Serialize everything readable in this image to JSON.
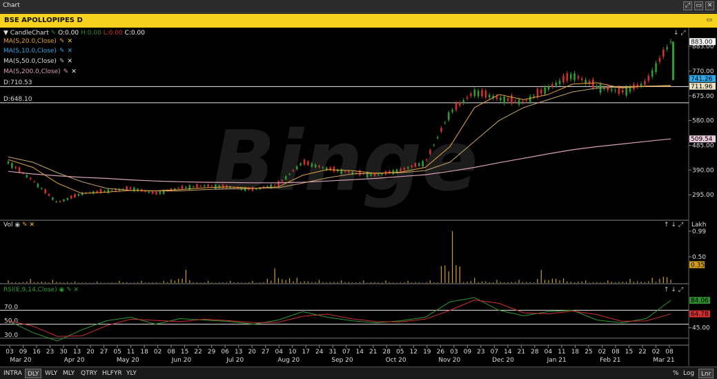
{
  "window": {
    "title": "Chart"
  },
  "window_controls": [
    "⤢",
    "▭",
    "✕"
  ],
  "chart_header": {
    "title": "BSE APOLLOPIPES D",
    "collapse_icon": "▭"
  },
  "ohlc": {
    "label": "CandleChart",
    "open": "O:0.00",
    "high": "H:0.00",
    "low": "L:0.00",
    "close": "C:0.00"
  },
  "indicators": [
    {
      "label": "MA(S,20.0,Close)",
      "color": "#e8a33a"
    },
    {
      "label": "MA(S,10.0,Close)",
      "color": "#2fa8e8"
    },
    {
      "label": "MA(S,50.0,Close)",
      "color": "#c9a46a"
    },
    {
      "label": "MA(S,200.0,Close)",
      "color": "#d9a0b8"
    }
  ],
  "hlines": [
    {
      "label": "D:710.53",
      "price": 710.53
    },
    {
      "label": "D:648.10",
      "price": 648.1
    }
  ],
  "price_axis": {
    "ticks": [
      "883.00",
      "770.00",
      "675.00",
      "580.00",
      "485.00",
      "390.00",
      "295.00"
    ],
    "tick_values": [
      865,
      770,
      675,
      580,
      485,
      390,
      295
    ],
    "ylim": [
      200,
      905
    ],
    "markers": [
      {
        "label": "883.00",
        "value": 883,
        "bg": "#ffffff",
        "fg": "#000000"
      },
      {
        "label": "741.26",
        "value": 741.26,
        "bg": "#2fa8e8",
        "fg": "#000000"
      },
      {
        "label": "711.96",
        "value": 711.96,
        "bg": "#e8e0c0",
        "fg": "#000000"
      },
      {
        "label": "509.54",
        "value": 509.54,
        "bg": "#e8c8d8",
        "fg": "#000000"
      }
    ]
  },
  "volume": {
    "label": "Vol",
    "unit": "Lakh",
    "ticks": [
      "0.99",
      "0.50"
    ],
    "tick_values": [
      0.99,
      0.5
    ],
    "ylim": [
      0,
      1.12
    ],
    "marker": {
      "label": "0.35",
      "value": 0.35
    }
  },
  "rsi": {
    "label": "RSI(E,9,14,Close)",
    "ticks": [
      "70.0",
      "50.0",
      "30.0"
    ],
    "tick_values": [
      70,
      50,
      30
    ],
    "right_ticks": [
      "45.00"
    ],
    "right_tick_values": [
      45
    ],
    "ylim": [
      20,
      100
    ],
    "markers": [
      {
        "label": "84.06",
        "value": 84.06,
        "bg": "#2e8b2e",
        "fg": "#000000"
      },
      {
        "label": "64.78",
        "value": 64.78,
        "bg": "#d23030",
        "fg": "#000000"
      }
    ]
  },
  "x_axis": {
    "days": [
      "03",
      "09",
      "16",
      "23",
      "30",
      "13",
      "20",
      "27",
      "05",
      "11",
      "18",
      "02",
      "08",
      "15",
      "22",
      "29",
      "06",
      "13",
      "20",
      "27",
      "04",
      "10",
      "17",
      "24",
      "31",
      "07",
      "14",
      "21",
      "28",
      "05",
      "12",
      "19",
      "26",
      "03",
      "09",
      "23",
      "07",
      "14",
      "21",
      "28",
      "04",
      "11",
      "18",
      "25",
      "02",
      "08",
      "15",
      "22",
      "02",
      "08"
    ],
    "months": [
      "Mar 20",
      "Apr 20",
      "May 20",
      "Jun 20",
      "Jul 20",
      "Aug 20",
      "Sep 20",
      "Oct 20",
      "Nov 20",
      "Dec 20",
      "Jan 21",
      "Feb 21",
      "Mar 21"
    ]
  },
  "watermark": "Binge",
  "period_tabs": [
    "INTRA",
    "DLY",
    "WLY",
    "MLY",
    "QTRY",
    "HLFYR",
    "YLY"
  ],
  "active_period": "DLY",
  "scale_tools": [
    "%",
    "Log",
    "Lnr"
  ],
  "active_scale": "Lnr",
  "chart_data": {
    "type": "line",
    "title": "BSE APOLLOPIPES D",
    "x": [
      "2020-03-03",
      "2020-03-16",
      "2020-03-30",
      "2020-04-13",
      "2020-04-27",
      "2020-05-11",
      "2020-05-25",
      "2020-06-08",
      "2020-06-22",
      "2020-07-06",
      "2020-07-20",
      "2020-08-03",
      "2020-08-17",
      "2020-08-31",
      "2020-09-14",
      "2020-09-28",
      "2020-10-12",
      "2020-10-26",
      "2020-11-09",
      "2020-11-23",
      "2020-12-07",
      "2020-12-21",
      "2021-01-04",
      "2021-01-18",
      "2021-02-01",
      "2021-02-15",
      "2021-03-01",
      "2021-03-08"
    ],
    "series": [
      {
        "name": "Close",
        "values": [
          420,
          350,
          265,
          300,
          310,
          320,
          300,
          322,
          330,
          325,
          315,
          335,
          420,
          395,
          380,
          370,
          390,
          420,
          610,
          690,
          665,
          650,
          705,
          755,
          710,
          690,
          725,
          883
        ]
      },
      {
        "name": "MA(S,20.0,Close)",
        "values": [
          430,
          400,
          340,
          300,
          305,
          312,
          310,
          315,
          322,
          325,
          320,
          325,
          370,
          392,
          388,
          377,
          382,
          400,
          480,
          630,
          680,
          660,
          680,
          720,
          725,
          705,
          712,
          712
        ]
      },
      {
        "name": "MA(S,50.0,Close)",
        "values": [
          440,
          420,
          380,
          345,
          320,
          312,
          310,
          310,
          315,
          318,
          320,
          322,
          340,
          360,
          375,
          378,
          380,
          388,
          420,
          500,
          580,
          630,
          660,
          690,
          705,
          708,
          712,
          715
        ]
      },
      {
        "name": "MA(S,200.0,Close)",
        "values": [
          385,
          375,
          368,
          362,
          358,
          352,
          348,
          345,
          343,
          342,
          341,
          341,
          343,
          348,
          353,
          358,
          365,
          372,
          385,
          400,
          418,
          435,
          452,
          468,
          480,
          490,
          500,
          509.54
        ]
      },
      {
        "name": "Vol",
        "values": [
          0.05,
          0.08,
          0.06,
          0.03,
          0.03,
          0.04,
          0.04,
          0.25,
          0.04,
          0.04,
          0.04,
          0.28,
          0.1,
          0.06,
          0.05,
          0.05,
          0.04,
          0.05,
          0.99,
          0.1,
          0.06,
          0.06,
          0.25,
          0.09,
          0.05,
          0.08,
          0.1,
          0.35
        ]
      },
      {
        "name": "RSI",
        "values": [
          55,
          38,
          26,
          42,
          55,
          60,
          50,
          58,
          56,
          54,
          50,
          56,
          68,
          60,
          55,
          52,
          55,
          60,
          82,
          88,
          70,
          62,
          68,
          70,
          56,
          52,
          58,
          84.06
        ]
      }
    ],
    "ylim": [
      200,
      905
    ]
  }
}
